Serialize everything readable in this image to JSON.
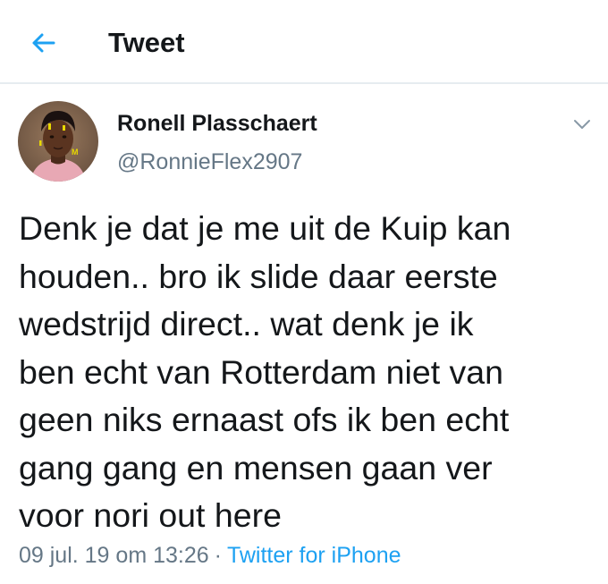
{
  "header": {
    "back_icon": "arrow-left-icon",
    "title": "Tweet"
  },
  "tweet": {
    "avatar_icon": "user-avatar-photo",
    "display_name": "Ronell Plasschaert",
    "handle": "@RonnieFlex2907",
    "caret_icon": "chevron-down-icon",
    "text": "Denk je dat je me uit de Kuip kan\nhouden.. bro ik slide daar eerste\nwedstrijd direct.. wat denk je ik\nben echt van Rotterdam niet van\ngeen niks ernaast ofs ik ben echt\ngang gang en mensen gaan ver\nvoor nori out here",
    "timestamp": "09 jul. 19 om 13:26",
    "separator": "·",
    "source": "Twitter for iPhone"
  },
  "colors": {
    "accent": "#1da1f2",
    "text_primary": "#14171a",
    "text_secondary": "#657786",
    "divider": "#e6ecf0"
  }
}
